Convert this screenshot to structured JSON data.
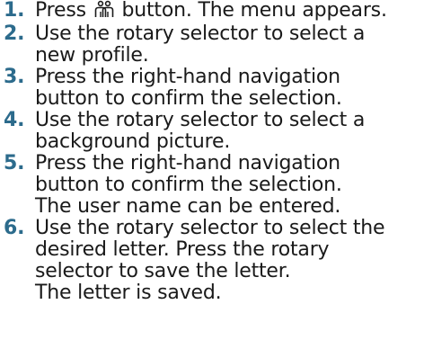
{
  "steps": [
    {
      "number": "1.",
      "lines": [
        "Press",
        "button. The menu appears."
      ],
      "icon": "user-profile-icon"
    },
    {
      "number": "2.",
      "lines": [
        "Use the rotary selector to select a",
        "new profile."
      ]
    },
    {
      "number": "3.",
      "lines": [
        "Press the right-hand navigation",
        "button to confirm the selection."
      ]
    },
    {
      "number": "4.",
      "lines": [
        "Use the rotary selector to select a",
        "background picture."
      ]
    },
    {
      "number": "5.",
      "lines": [
        "Press the right-hand navigation",
        "button to confirm the selection.",
        "The user name can be entered."
      ]
    },
    {
      "number": "6.",
      "lines": [
        "Use the rotary selector to select the",
        "desired letter. Press the rotary",
        "selector to save the letter.",
        "The letter is saved."
      ]
    }
  ],
  "colors": {
    "step_number": "#2c6b8c",
    "text": "#1a1a1a"
  }
}
